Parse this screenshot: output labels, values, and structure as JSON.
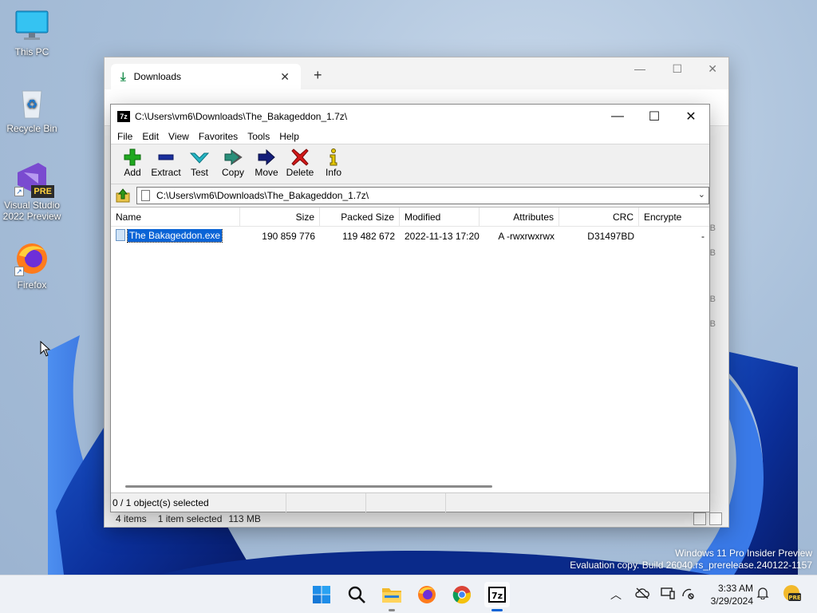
{
  "desktop": {
    "icons": [
      {
        "label": "This PC",
        "icon": "monitor-icon"
      },
      {
        "label": "Recycle Bin",
        "icon": "recycle-bin-icon"
      },
      {
        "label": "Visual Studio 2022 Preview",
        "badge": "PRE",
        "icon": "visual-studio-icon"
      },
      {
        "label": "Firefox",
        "icon": "firefox-icon"
      }
    ]
  },
  "explorer": {
    "tab_title": "Downloads",
    "new_tab": "+",
    "status_items": "4 items",
    "status_selected": "1 item selected",
    "status_size": "113 MB",
    "right_letters": [
      "B",
      "B",
      "B",
      "B"
    ]
  },
  "zip": {
    "title": "C:\\Users\\vm6\\Downloads\\The_Bakageddon_1.7z\\",
    "logo": "7z",
    "menu": [
      "File",
      "Edit",
      "View",
      "Favorites",
      "Tools",
      "Help"
    ],
    "toolbar": [
      {
        "label": "Add",
        "icon": "plus-icon",
        "color": "#1fa81f"
      },
      {
        "label": "Extract",
        "icon": "minus-icon",
        "color": "#1a2f9c"
      },
      {
        "label": "Test",
        "icon": "check-icon",
        "color": "#25b5c4"
      },
      {
        "label": "Copy",
        "icon": "double-arrow-icon",
        "color": "#2a8f7a"
      },
      {
        "label": "Move",
        "icon": "arrow-right-icon",
        "color": "#141e7a"
      },
      {
        "label": "Delete",
        "icon": "x-icon",
        "color": "#d21818"
      },
      {
        "label": "Info",
        "icon": "info-icon",
        "color": "#e6c800"
      }
    ],
    "address": "C:\\Users\\vm6\\Downloads\\The_Bakageddon_1.7z\\",
    "columns": [
      "Name",
      "Size",
      "Packed Size",
      "Modified",
      "Attributes",
      "CRC",
      "Encrypte"
    ],
    "rows": [
      {
        "name": "The Bakageddon.exe",
        "size": "190 859 776",
        "packed": "119 482 672",
        "modified": "2022-11-13 17:20",
        "attributes": "A -rwxrwxrwx",
        "crc": "D31497BD",
        "encrypted": "-"
      }
    ],
    "status": "0 / 1 object(s) selected"
  },
  "watermark": {
    "line1": "Windows 11 Pro Insider Preview",
    "line2": "Evaluation copy. Build 26040.rs_prerelease.240122-1157"
  },
  "taskbar": {
    "time": "3:33 AM",
    "date": "3/29/2024",
    "apps": [
      "start-icon",
      "search-icon",
      "file-explorer-icon",
      "firefox-icon",
      "chrome-icon",
      "7zip-icon"
    ]
  }
}
